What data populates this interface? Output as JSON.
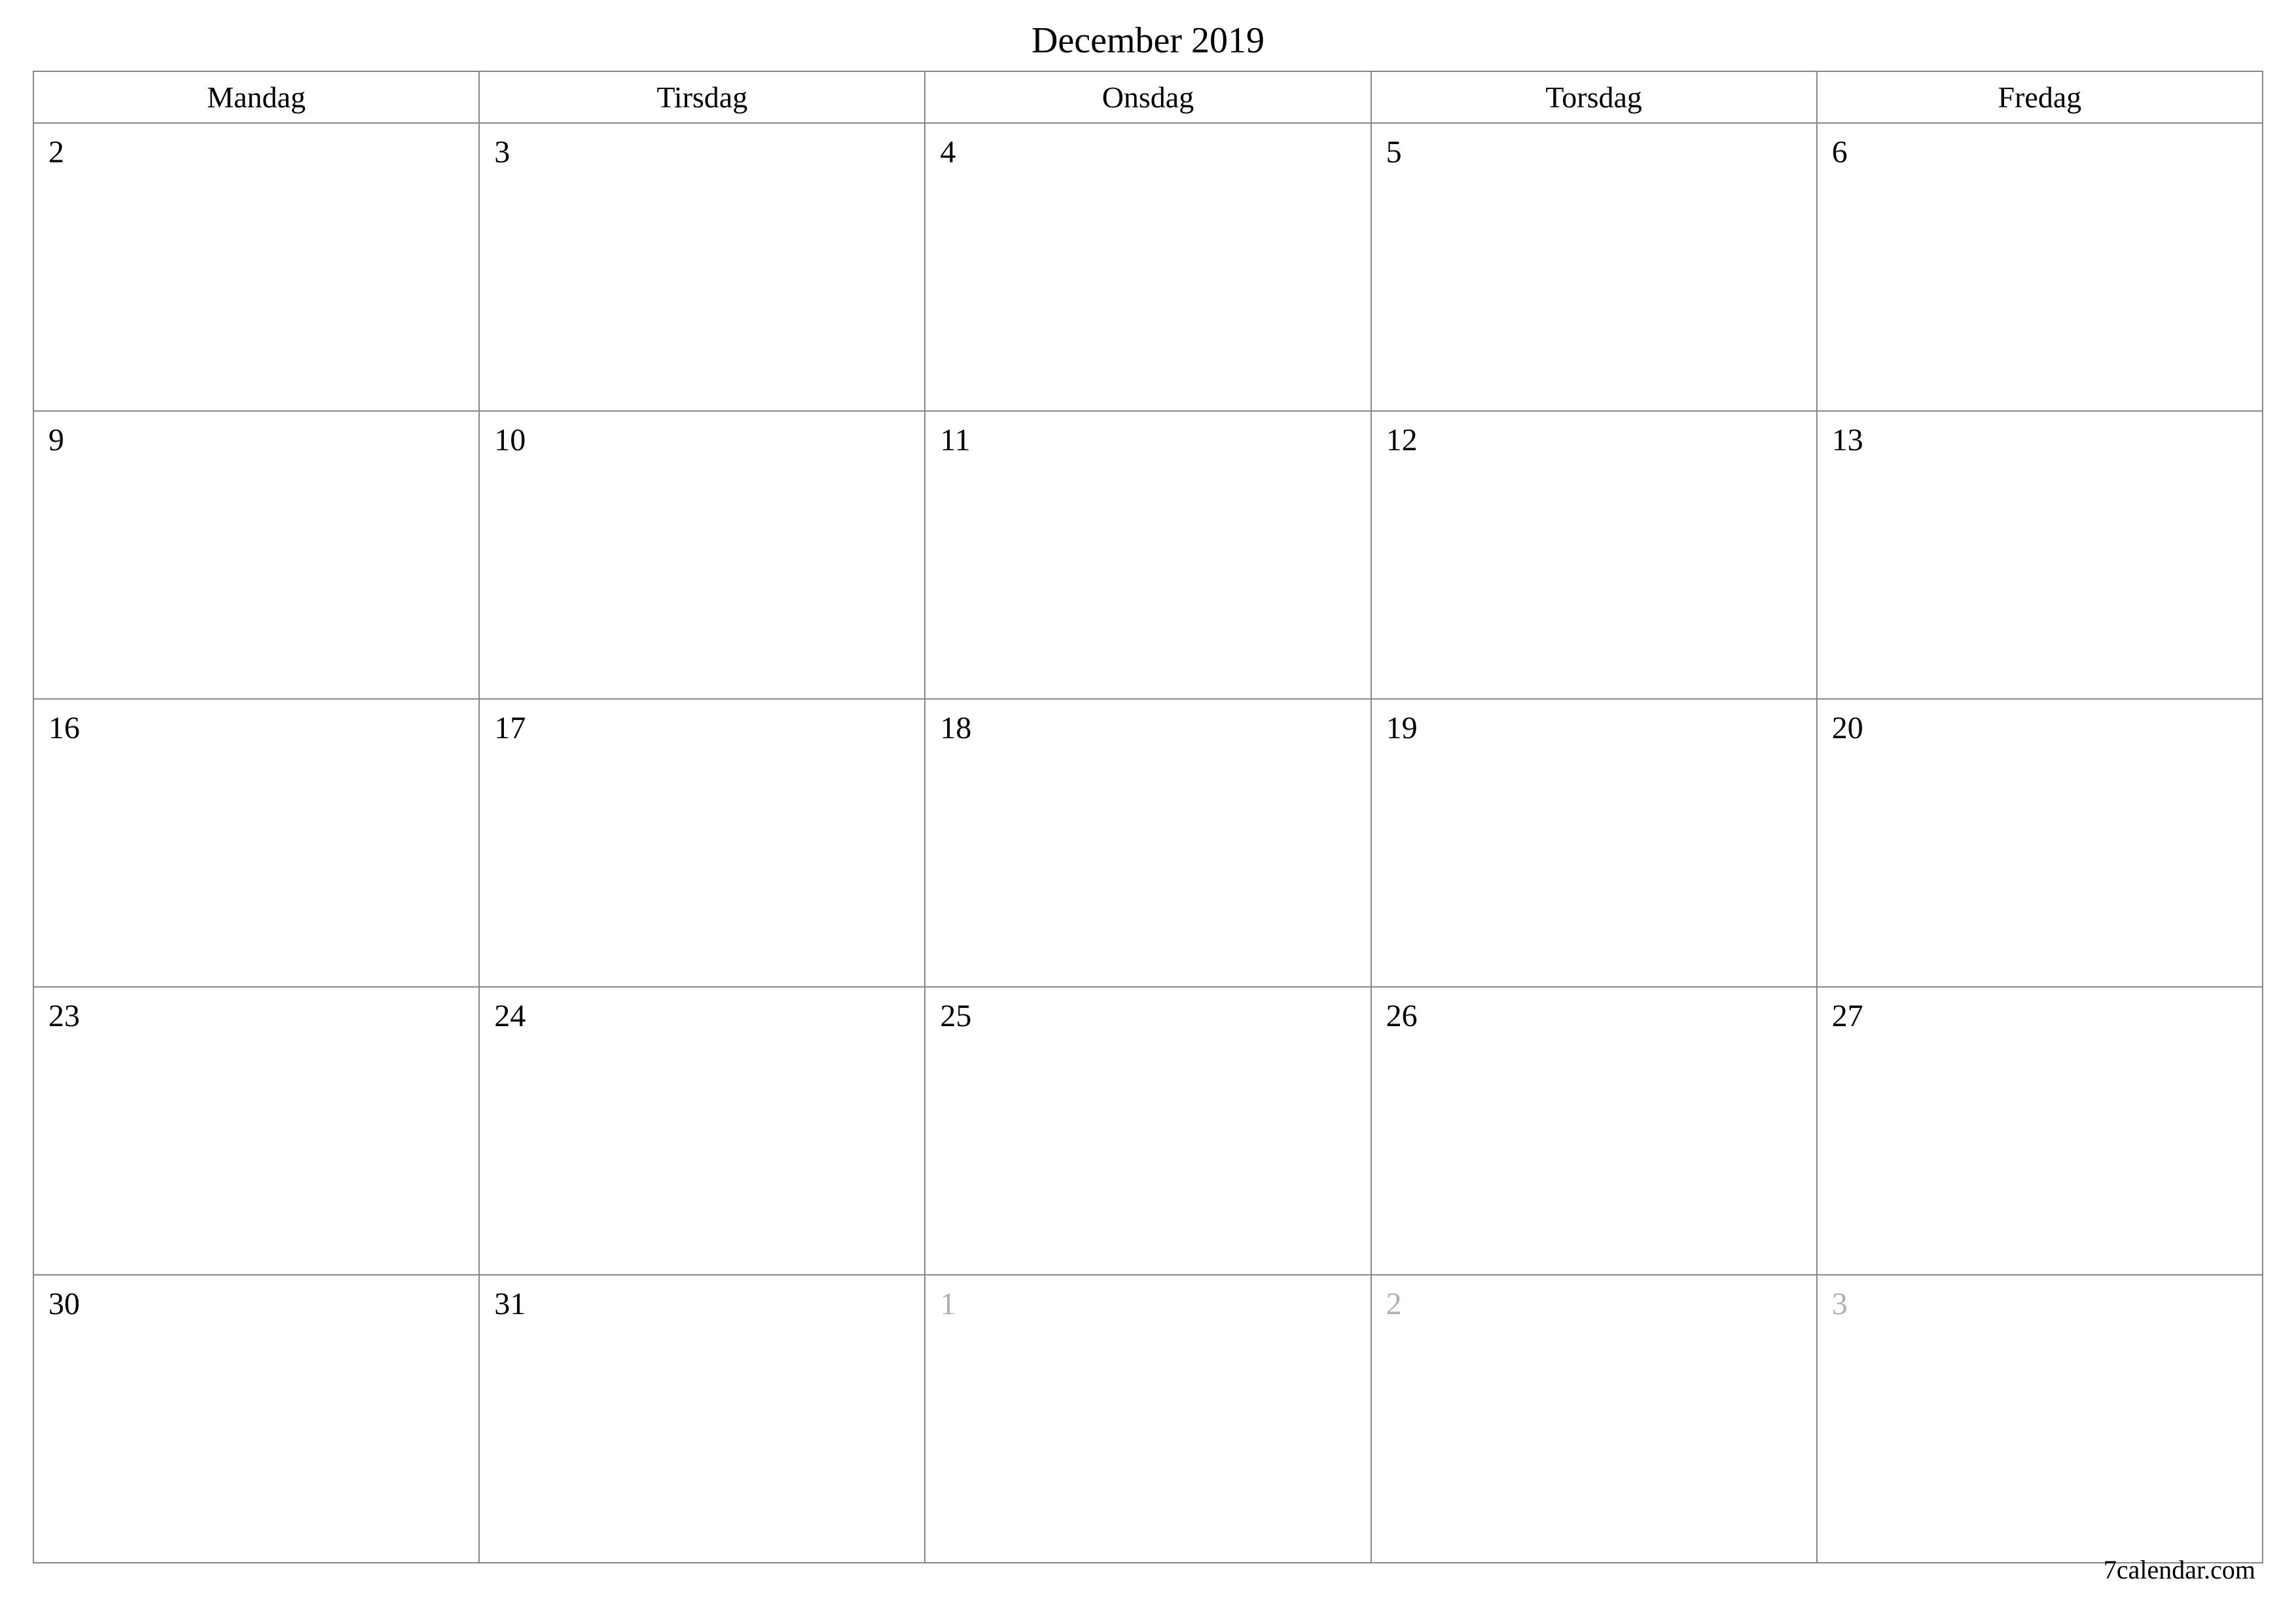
{
  "title": "December 2019",
  "headers": [
    "Mandag",
    "Tirsdag",
    "Onsdag",
    "Torsdag",
    "Fredag"
  ],
  "weeks": [
    [
      {
        "day": "2",
        "other": false
      },
      {
        "day": "3",
        "other": false
      },
      {
        "day": "4",
        "other": false
      },
      {
        "day": "5",
        "other": false
      },
      {
        "day": "6",
        "other": false
      }
    ],
    [
      {
        "day": "9",
        "other": false
      },
      {
        "day": "10",
        "other": false
      },
      {
        "day": "11",
        "other": false
      },
      {
        "day": "12",
        "other": false
      },
      {
        "day": "13",
        "other": false
      }
    ],
    [
      {
        "day": "16",
        "other": false
      },
      {
        "day": "17",
        "other": false
      },
      {
        "day": "18",
        "other": false
      },
      {
        "day": "19",
        "other": false
      },
      {
        "day": "20",
        "other": false
      }
    ],
    [
      {
        "day": "23",
        "other": false
      },
      {
        "day": "24",
        "other": false
      },
      {
        "day": "25",
        "other": false
      },
      {
        "day": "26",
        "other": false
      },
      {
        "day": "27",
        "other": false
      }
    ],
    [
      {
        "day": "30",
        "other": false
      },
      {
        "day": "31",
        "other": false
      },
      {
        "day": "1",
        "other": true
      },
      {
        "day": "2",
        "other": true
      },
      {
        "day": "3",
        "other": true
      }
    ]
  ],
  "footer": "7calendar.com"
}
